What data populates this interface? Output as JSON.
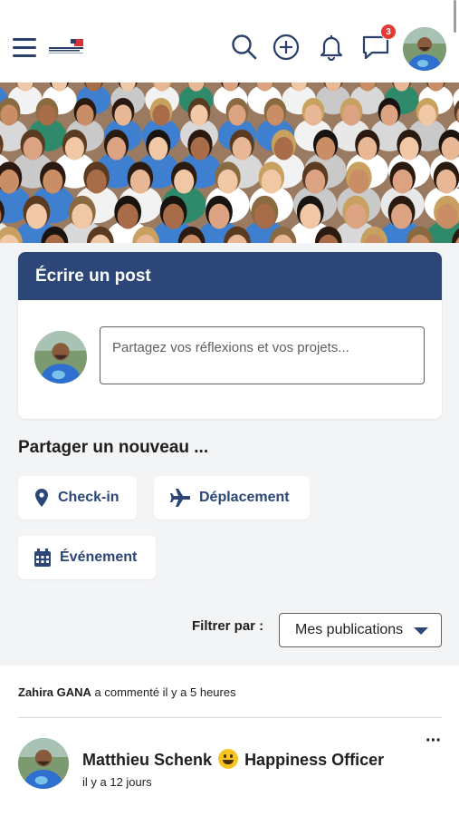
{
  "header": {
    "logo_text": "INSTITUT DE L'ENGAGEMENT",
    "notifications_count": "3",
    "icons": [
      "menu-icon",
      "search-icon",
      "plus-circle-icon",
      "bell-icon",
      "chat-icon"
    ]
  },
  "composer": {
    "title": "Écrire un post",
    "placeholder": "Partagez vos réflexions et vos projets..."
  },
  "share": {
    "title": "Partager un nouveau ...",
    "buttons": [
      {
        "label": "Check-in",
        "icon": "map-pin-icon"
      },
      {
        "label": "Déplacement",
        "icon": "plane-icon"
      },
      {
        "label": "Événement",
        "icon": "calendar-icon"
      }
    ]
  },
  "filter": {
    "label": "Filtrer par :",
    "selected": "Mes publications"
  },
  "feed": {
    "activity_user": "Zahira GANA",
    "activity_text": " a commenté il y a 5 heures",
    "post": {
      "author": "Matthieu Schenk",
      "role": "Happiness Officer",
      "time": "il y a 12 jours"
    }
  },
  "colors": {
    "primary": "#2b4677",
    "badge": "#e53935",
    "background": "#f3f4f6"
  }
}
